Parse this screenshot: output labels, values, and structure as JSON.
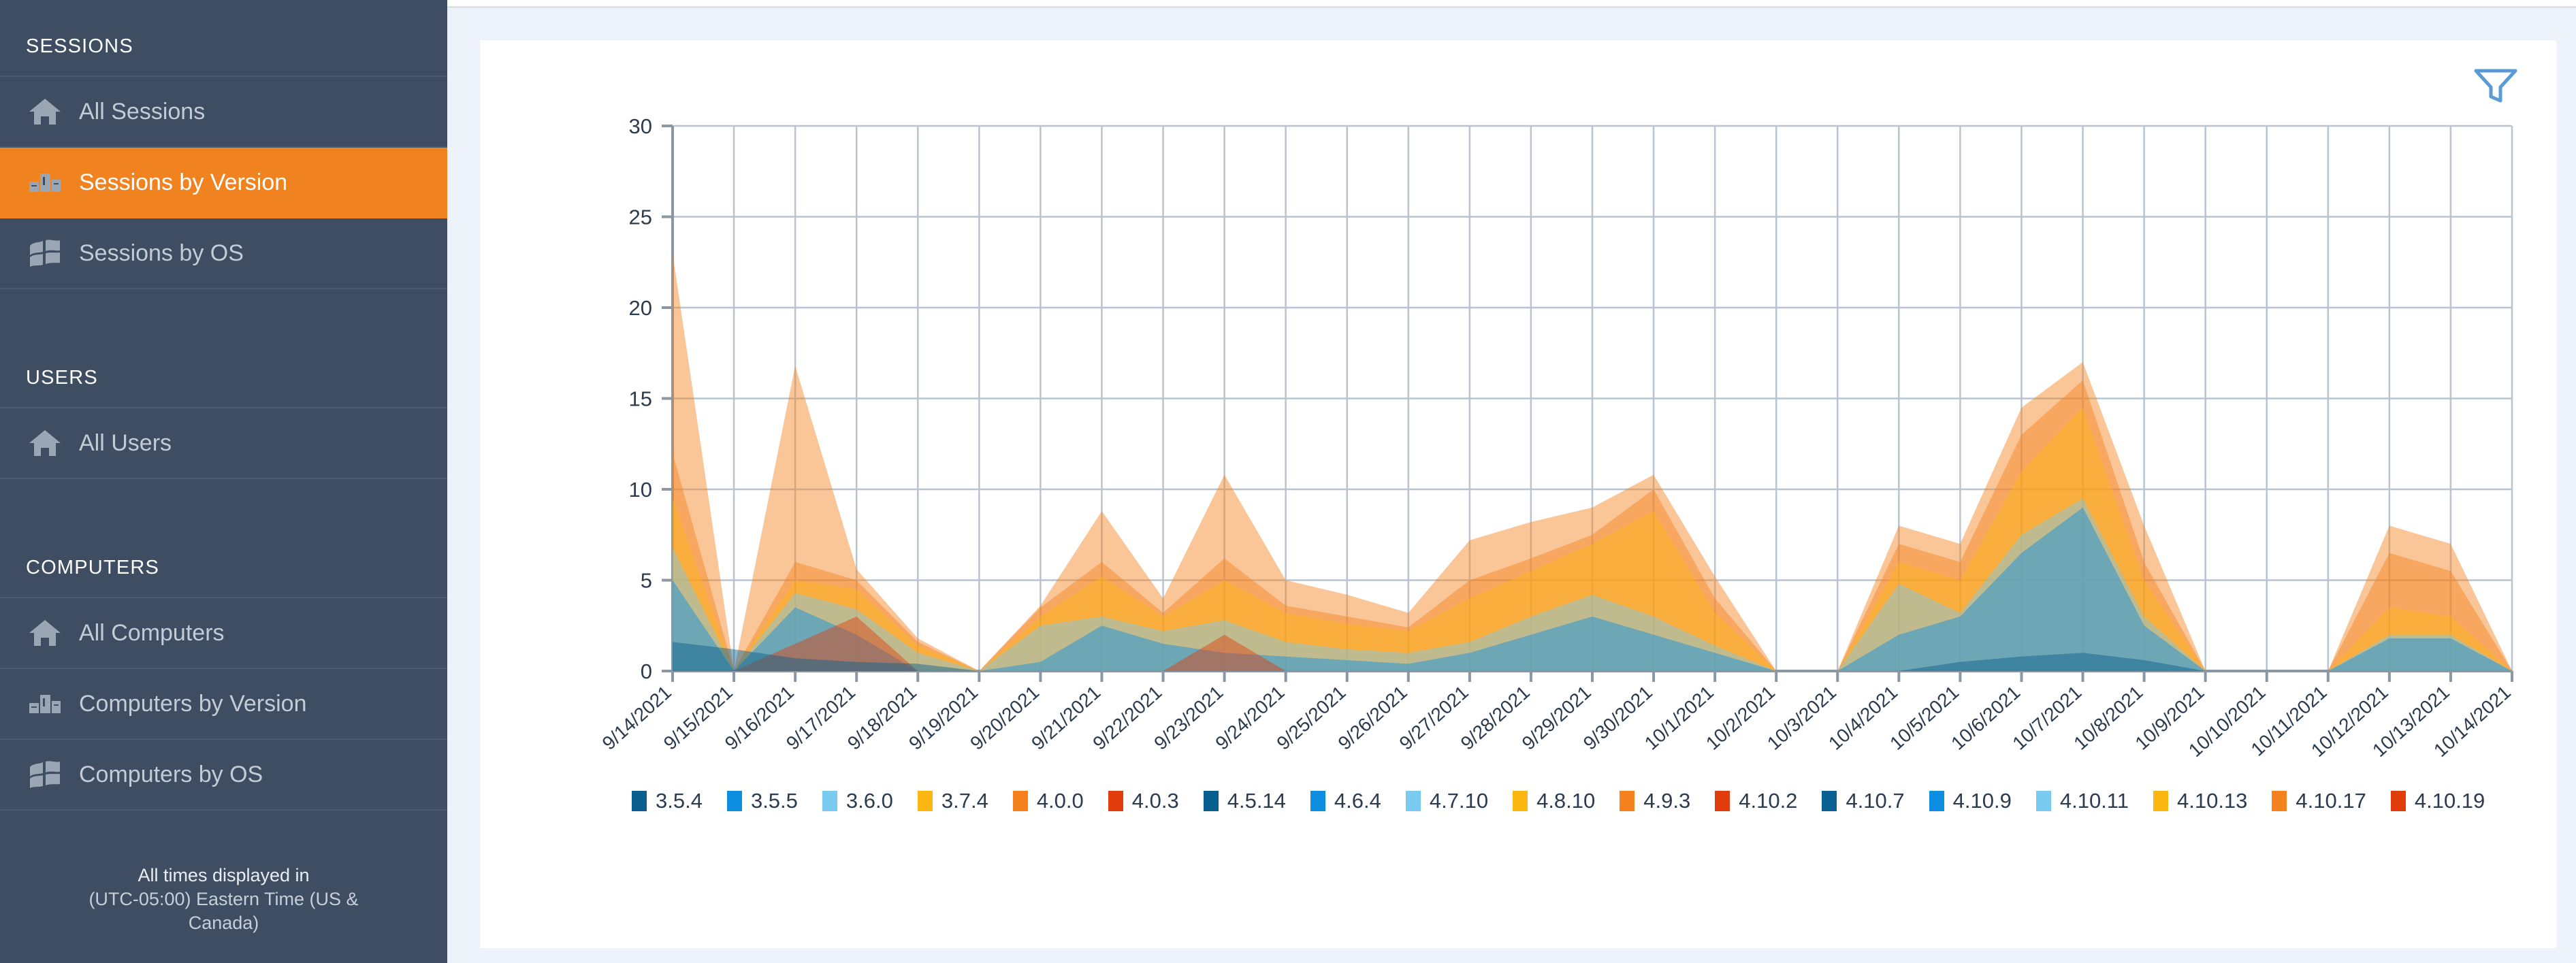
{
  "sidebar": {
    "groups": [
      {
        "title": "SESSIONS",
        "items": [
          {
            "label": "All Sessions",
            "icon": "home-icon",
            "active": false
          },
          {
            "label": "Sessions by Version",
            "icon": "podium-icon",
            "active": true
          },
          {
            "label": "Sessions by OS",
            "icon": "windows-icon",
            "active": false
          }
        ]
      },
      {
        "title": "USERS",
        "items": [
          {
            "label": "All Users",
            "icon": "home-icon",
            "active": false
          }
        ]
      },
      {
        "title": "COMPUTERS",
        "items": [
          {
            "label": "All Computers",
            "icon": "home-icon",
            "active": false
          },
          {
            "label": "Computers by Version",
            "icon": "podium-icon",
            "active": false
          },
          {
            "label": "Computers by OS",
            "icon": "windows-icon",
            "active": false
          }
        ]
      }
    ],
    "timezone_note_line1": "All times displayed in",
    "timezone_note_line2": "(UTC-05:00) Eastern Time (US &",
    "timezone_note_line3": "Canada)"
  },
  "toolbar": {
    "filter_icon": "filter-funnel-icon",
    "filter_color": "#5b9bd5"
  },
  "colors": {
    "sidebar_bg": "#3e4d61",
    "sidebar_active": "#f18220",
    "page_bg": "#eef2fb",
    "card_bg": "#ffffff",
    "grid": "#b8c4cf",
    "axis_text": "#2d3b4e"
  },
  "chart_data": {
    "type": "area",
    "stacked": false,
    "title": "",
    "xlabel": "",
    "ylabel": "",
    "ylim": [
      0,
      30
    ],
    "yticks": [
      0,
      5,
      10,
      15,
      20,
      25,
      30
    ],
    "grid": true,
    "legend_position": "bottom",
    "categories": [
      "9/14/2021",
      "9/15/2021",
      "9/16/2021",
      "9/17/2021",
      "9/18/2021",
      "9/19/2021",
      "9/20/2021",
      "9/21/2021",
      "9/22/2021",
      "9/23/2021",
      "9/24/2021",
      "9/25/2021",
      "9/26/2021",
      "9/27/2021",
      "9/28/2021",
      "9/29/2021",
      "9/30/2021",
      "10/1/2021",
      "10/2/2021",
      "10/3/2021",
      "10/4/2021",
      "10/5/2021",
      "10/6/2021",
      "10/7/2021",
      "10/8/2021",
      "10/9/2021",
      "10/10/2021",
      "10/11/2021",
      "10/12/2021",
      "10/13/2021",
      "10/14/2021"
    ],
    "series": [
      {
        "name": "3.5.4",
        "color": "#085e8e",
        "values": [
          0,
          0,
          0,
          0,
          0,
          0,
          0,
          0,
          0,
          0,
          0,
          0,
          0,
          0,
          0,
          0,
          0,
          0,
          0,
          0,
          0,
          0,
          0,
          0,
          0,
          0,
          0,
          0,
          0,
          0,
          0
        ]
      },
      {
        "name": "3.5.5",
        "color": "#0d8ee0",
        "values": [
          0,
          0,
          0,
          0,
          0,
          0,
          0,
          0,
          0,
          0,
          0,
          0,
          0,
          0,
          0,
          0,
          0,
          0,
          0,
          0,
          0,
          0,
          0,
          0,
          0,
          0,
          0,
          0,
          0,
          0,
          0
        ]
      },
      {
        "name": "3.6.0",
        "color": "#79cbf0",
        "values": [
          0,
          0,
          0,
          0,
          0,
          0,
          0,
          0,
          0,
          0,
          0,
          0,
          0,
          0,
          0,
          0,
          0,
          0,
          0,
          0,
          0,
          0,
          0,
          0,
          0,
          0,
          0,
          0,
          0,
          0,
          0
        ]
      },
      {
        "name": "3.7.4",
        "color": "#fcb713",
        "values": [
          0,
          0,
          0,
          0,
          0,
          0,
          0,
          0,
          0,
          0,
          0,
          0,
          0,
          0,
          0,
          0,
          0,
          0,
          0,
          0,
          0,
          0,
          0,
          0,
          0,
          0,
          0,
          0,
          0,
          0,
          0
        ]
      },
      {
        "name": "4.0.0",
        "color": "#f5821f",
        "values": [
          0,
          0,
          0,
          0,
          0,
          0,
          0,
          0,
          0,
          0,
          0,
          0,
          0,
          0,
          0,
          0,
          0,
          0,
          0,
          0,
          0,
          0,
          0,
          0,
          0,
          0,
          0,
          0,
          0,
          0,
          0
        ]
      },
      {
        "name": "4.0.3",
        "color": "#e03c0c",
        "values": [
          0,
          0,
          0,
          0,
          0,
          0,
          0,
          0,
          0,
          0,
          0,
          0,
          0,
          0,
          0,
          0,
          0,
          0,
          0,
          0,
          0,
          0,
          0,
          0,
          0,
          0,
          0,
          0,
          0,
          0,
          0
        ]
      },
      {
        "name": "4.5.14",
        "color": "#085e8e",
        "values": [
          1.6,
          1.2,
          0.7,
          0.5,
          0.4,
          0,
          0,
          0,
          0,
          0,
          0,
          0,
          0,
          0,
          0,
          0,
          0,
          0,
          0,
          0,
          0,
          0.5,
          0.8,
          1.0,
          0.6,
          0,
          0,
          0,
          0,
          0,
          0
        ]
      },
      {
        "name": "4.6.4",
        "color": "#0d8ee0",
        "values": [
          5.0,
          0,
          3.5,
          2.0,
          0,
          0,
          0.5,
          2.5,
          1.5,
          1.0,
          0.8,
          0.6,
          0.4,
          1.0,
          2.0,
          3.0,
          2.0,
          1.0,
          0,
          0,
          2.0,
          3.0,
          6.5,
          9.0,
          2.5,
          0,
          0,
          0,
          1.8,
          1.8,
          0
        ]
      },
      {
        "name": "4.7.10",
        "color": "#79cbf0",
        "values": [
          6.8,
          0,
          4.3,
          3.4,
          1.0,
          0,
          2.5,
          3.0,
          2.2,
          2.8,
          1.6,
          1.2,
          1.0,
          1.6,
          3.0,
          4.2,
          3.0,
          1.4,
          0,
          0,
          4.8,
          3.2,
          7.5,
          9.5,
          3.0,
          0,
          0,
          0,
          2.0,
          2.0,
          0
        ]
      },
      {
        "name": "4.8.10",
        "color": "#fcb713",
        "values": [
          9.5,
          0,
          5.0,
          4.5,
          1.4,
          0,
          3.0,
          5.2,
          3.0,
          5.0,
          3.2,
          2.6,
          2.2,
          4.0,
          5.5,
          7.0,
          8.8,
          3.2,
          0,
          0,
          6.0,
          5.0,
          11.0,
          14.5,
          5.0,
          0,
          0,
          0,
          3.5,
          3.0,
          0
        ]
      },
      {
        "name": "4.9.3",
        "color": "#f5821f",
        "values": [
          12.0,
          0,
          6.0,
          5.0,
          1.6,
          0,
          3.5,
          6.0,
          3.2,
          6.2,
          3.6,
          3.0,
          2.4,
          5.0,
          6.2,
          7.5,
          10.0,
          4.0,
          0,
          0,
          7.0,
          6.0,
          13.0,
          16.0,
          6.0,
          0,
          0,
          0,
          6.5,
          5.5,
          0
        ]
      },
      {
        "name": "4.10.2",
        "color": "#e03c0c",
        "values": [
          0,
          0,
          1.5,
          3.0,
          0,
          0,
          0,
          0,
          0,
          2.0,
          0,
          0,
          0,
          0,
          0,
          0,
          0,
          0,
          0,
          0,
          0,
          0,
          0,
          0,
          0,
          0,
          0,
          0,
          0,
          0,
          0
        ]
      },
      {
        "name": "4.10.7",
        "color": "#0a5f93",
        "values": [
          0,
          0,
          0,
          0,
          0,
          0,
          0,
          0,
          0,
          0,
          0,
          0,
          0,
          0,
          0,
          0,
          0,
          0,
          0,
          0,
          0,
          0,
          0,
          0,
          0,
          0,
          0,
          0,
          0,
          0,
          0
        ]
      },
      {
        "name": "4.10.9",
        "color": "#0d8ee0",
        "values": [
          0,
          0,
          0,
          0,
          0,
          0,
          0,
          0,
          0,
          0,
          0,
          0,
          0,
          0,
          0,
          0,
          0,
          0,
          0,
          0,
          0,
          0,
          0,
          0,
          0,
          0,
          0,
          0,
          0,
          0,
          0
        ]
      },
      {
        "name": "4.10.11",
        "color": "#79cbf0",
        "values": [
          0,
          0,
          0,
          0,
          0,
          0,
          0,
          0,
          0,
          0,
          0,
          0,
          0,
          0,
          0,
          0,
          0,
          0,
          0,
          0,
          0,
          0,
          0,
          0,
          0,
          0,
          0,
          0,
          0,
          0,
          0
        ]
      },
      {
        "name": "4.10.13",
        "color": "#fcb713",
        "values": [
          0,
          0,
          0,
          0,
          0,
          0,
          0,
          0,
          0,
          0,
          0,
          0,
          0,
          0,
          0,
          0,
          0,
          0,
          0,
          0,
          0,
          0,
          0,
          0,
          0,
          0,
          0,
          0,
          0,
          0,
          0
        ]
      },
      {
        "name": "4.10.17",
        "color": "#f5821f",
        "values": [
          23.0,
          0,
          16.8,
          5.6,
          1.8,
          0,
          3.6,
          8.8,
          4.0,
          10.8,
          5.0,
          4.2,
          3.2,
          7.2,
          8.2,
          9.0,
          10.8,
          5.2,
          0,
          0,
          8.0,
          7.0,
          14.5,
          17.0,
          8.0,
          0,
          0,
          0,
          8.0,
          7.0,
          0
        ]
      },
      {
        "name": "4.10.19",
        "color": "#e03c0c",
        "values": [
          0,
          0,
          0,
          0,
          0,
          0,
          0,
          0,
          0,
          0,
          0,
          0,
          0,
          0,
          0,
          0,
          0,
          0,
          0,
          0,
          0,
          0,
          0,
          0,
          0,
          0,
          0,
          0,
          0,
          0,
          0
        ]
      }
    ]
  }
}
